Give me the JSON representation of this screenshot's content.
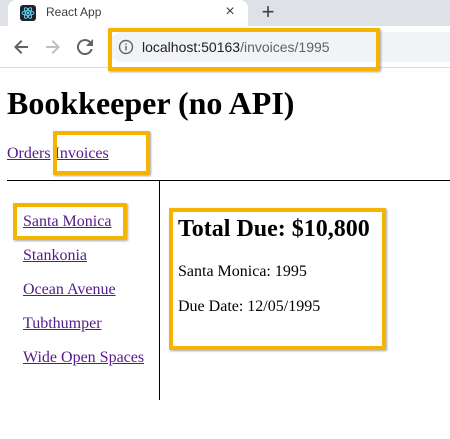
{
  "browser": {
    "tab_title": "React App",
    "tab_close_glyph": "×",
    "new_tab_glyph": "+",
    "url_host": "localhost:50163",
    "url_path": "/invoices/1995",
    "icons": [
      "react-favicon-icon",
      "close-icon",
      "plus-icon",
      "back-arrow-icon",
      "forward-arrow-icon",
      "reload-icon",
      "info-icon"
    ]
  },
  "app": {
    "title": "Bookkeeper (no API)",
    "nav": {
      "orders": "Orders",
      "invoices": "Invoices"
    },
    "invoices": [
      {
        "label": "Santa Monica"
      },
      {
        "label": "Stankonia"
      },
      {
        "label": "Ocean Avenue"
      },
      {
        "label": "Tubthumper"
      },
      {
        "label": "Wide Open Spaces"
      }
    ],
    "detail": {
      "total_due": "Total Due: $10,800",
      "name_number": "Santa Monica: 1995",
      "due_date": "Due Date: 12/05/1995"
    }
  },
  "colors": {
    "highlight": "#f4b400",
    "visited_link": "#551a8b"
  }
}
